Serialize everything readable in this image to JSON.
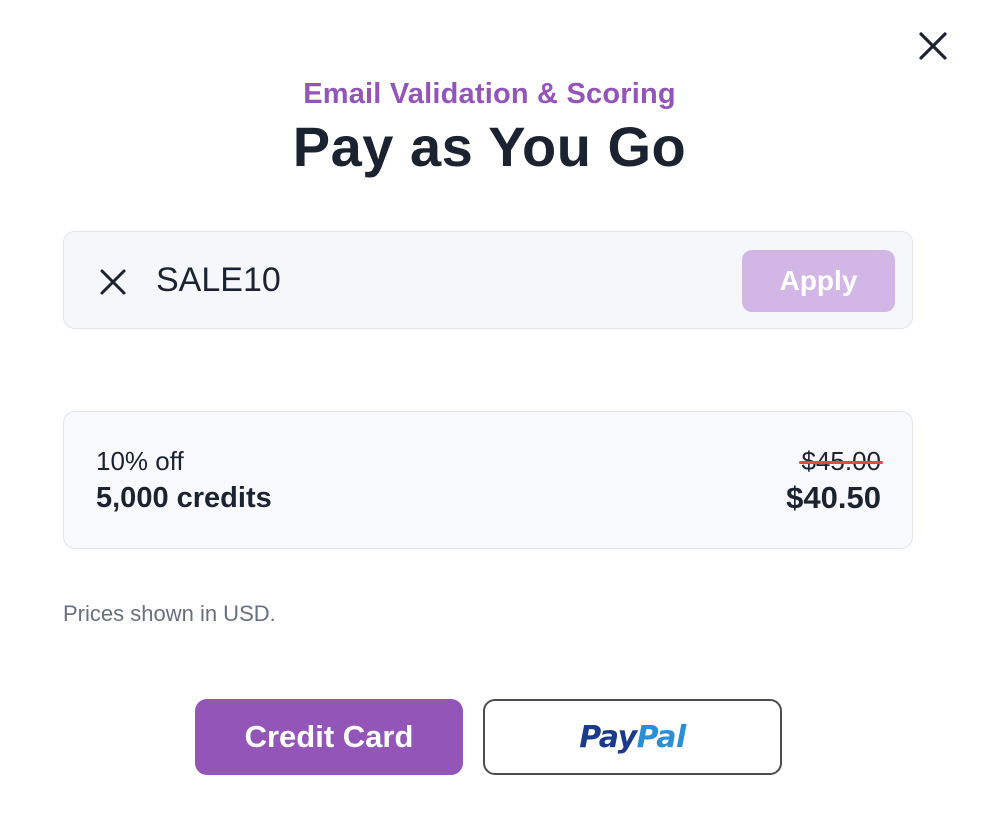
{
  "modal": {
    "subtitle": "Email Validation & Scoring",
    "title": "Pay as You Go",
    "close_icon": "close-icon"
  },
  "coupon": {
    "clear_icon": "close-icon",
    "code": "SALE10",
    "apply_label": "Apply"
  },
  "pricing": {
    "discount": "10% off",
    "credits": "5,000 credits",
    "original_price": "$45.00",
    "discounted_price": "$40.50"
  },
  "note": "Prices shown in USD.",
  "payment": {
    "credit_card_label": "Credit Card",
    "paypal_logo": {
      "pay": "Pay",
      "pal": "Pal"
    }
  },
  "colors": {
    "accent": "#9355b8",
    "apply_disabled": "#d2b7e6",
    "strike": "#e24a4a",
    "paypal_dark": "#1b3a8a",
    "paypal_light": "#2b8fd6"
  }
}
